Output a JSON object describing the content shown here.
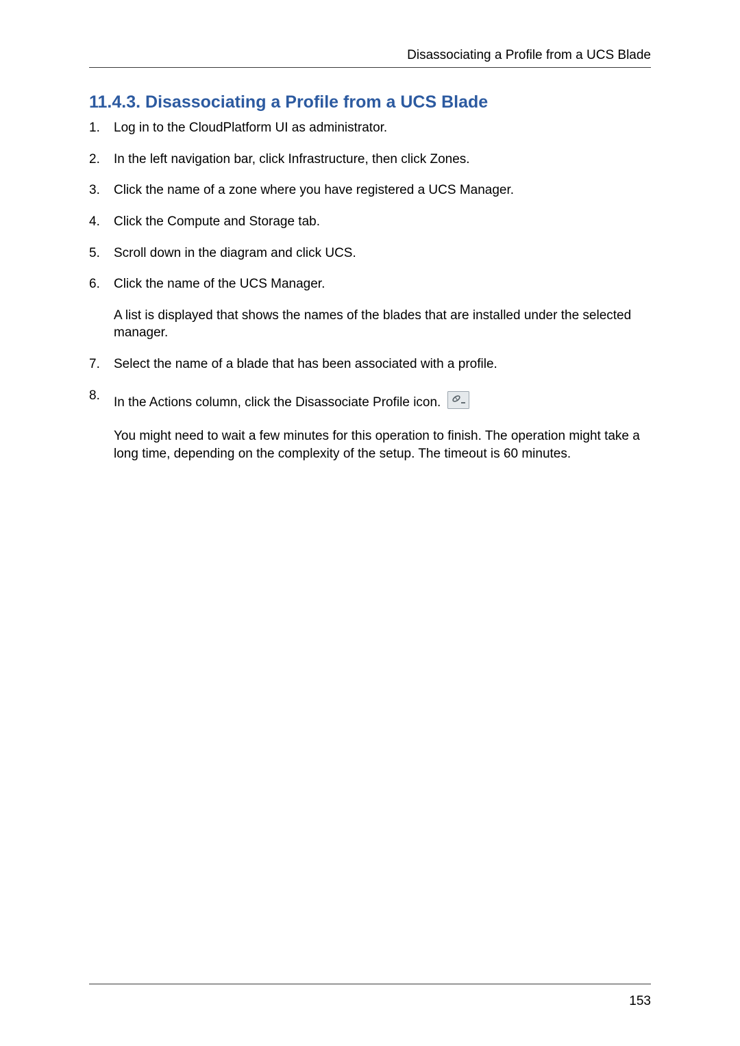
{
  "header": {
    "running_title": "Disassociating a Profile from a UCS Blade"
  },
  "section": {
    "title": "11.4.3. Disassociating a Profile from a UCS Blade"
  },
  "steps": [
    {
      "text": "Log in to the CloudPlatform UI as administrator."
    },
    {
      "text": "In the left navigation bar, click Infrastructure, then click Zones."
    },
    {
      "text": "Click the name of a zone where you have registered a UCS Manager."
    },
    {
      "text": "Click the Compute and Storage tab."
    },
    {
      "text": "Scroll down in the diagram and click UCS."
    },
    {
      "text": "Click the name of the UCS Manager.",
      "extra": "A list is displayed that shows the names of the blades that are installed under the selected manager."
    },
    {
      "text": "Select the name of a blade that has been associated with a profile."
    },
    {
      "text": "In the Actions column, click the Disassociate Profile icon.",
      "has_icon": true,
      "extra": "You might need to wait a few minutes for this operation to finish. The operation might take a long time, depending on the complexity of the setup. The timeout is 60 minutes."
    }
  ],
  "footer": {
    "page_number": "153"
  }
}
